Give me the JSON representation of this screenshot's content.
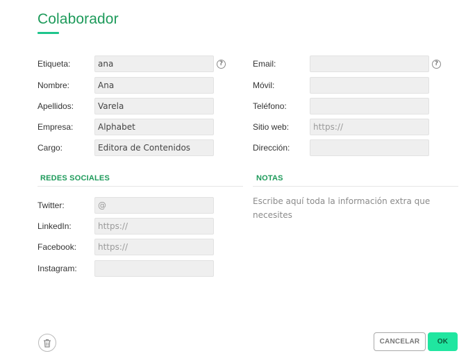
{
  "header": {
    "title": "Colaborador"
  },
  "left_fields": [
    {
      "label": "Etiqueta:",
      "value": "ana",
      "placeholder": ""
    },
    {
      "label": "Nombre:",
      "value": "Ana",
      "placeholder": ""
    },
    {
      "label": "Apellidos:",
      "value": "Varela",
      "placeholder": ""
    },
    {
      "label": "Empresa:",
      "value": "Alphabet",
      "placeholder": ""
    },
    {
      "label": "Cargo:",
      "value": "Editora de Contenidos",
      "placeholder": ""
    }
  ],
  "right_fields": [
    {
      "label": "Email:",
      "value": "",
      "placeholder": ""
    },
    {
      "label": "Móvil:",
      "value": "",
      "placeholder": ""
    },
    {
      "label": "Teléfono:",
      "value": "",
      "placeholder": ""
    },
    {
      "label": "Sitio web:",
      "value": "",
      "placeholder": "https://"
    },
    {
      "label": "Dirección:",
      "value": "",
      "placeholder": ""
    }
  ],
  "help_icon": "?",
  "social": {
    "title": "REDES SOCIALES",
    "fields": [
      {
        "label": "Twitter:",
        "value": "",
        "placeholder": "@"
      },
      {
        "label": "LinkedIn:",
        "value": "",
        "placeholder": "https://"
      },
      {
        "label": "Facebook:",
        "value": "",
        "placeholder": "https://"
      },
      {
        "label": "Instagram:",
        "value": "",
        "placeholder": ""
      }
    ]
  },
  "notes": {
    "title": "NOTAS",
    "placeholder": "Escribe aquí toda la información extra que necesites"
  },
  "footer": {
    "delete_icon": "trash-icon",
    "cancel_label": "CANCELAR",
    "ok_label": "OK"
  },
  "colors": {
    "accent": "#1d9a5a",
    "ok_button": "#20e6a0",
    "field_bg": "#efefef"
  }
}
